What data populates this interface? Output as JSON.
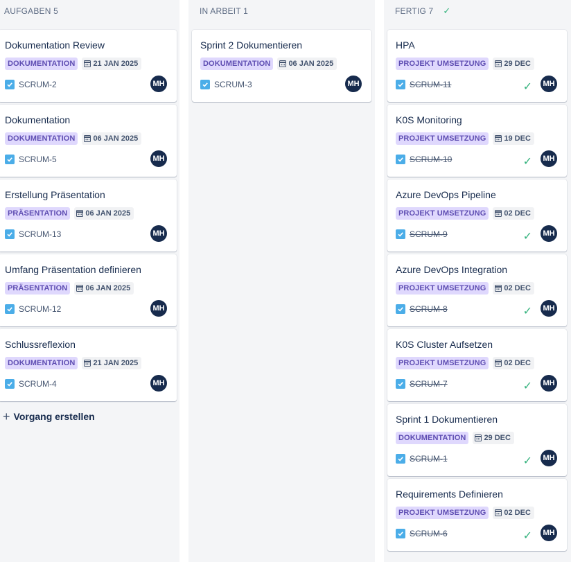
{
  "columns": [
    {
      "id": "todo",
      "title": "AUFGABEN 5",
      "cards": [
        {
          "title": "Dokumentation Review",
          "label": "DOKUMENTATION",
          "date": "21 JAN 2025",
          "key": "SCRUM-2",
          "assignee": "MH"
        },
        {
          "title": "Dokumentation",
          "label": "DOKUMENTATION",
          "date": "06 JAN 2025",
          "key": "SCRUM-5",
          "assignee": "MH"
        },
        {
          "title": "Erstellung Präsentation",
          "label": "PRÄSENTATION",
          "date": "06 JAN 2025",
          "key": "SCRUM-13",
          "assignee": "MH"
        },
        {
          "title": "Umfang Präsentation definieren",
          "label": "PRÄSENTATION",
          "date": "06 JAN 2025",
          "key": "SCRUM-12",
          "assignee": "MH"
        },
        {
          "title": "Schlussreflexion",
          "label": "DOKUMENTATION",
          "date": "21 JAN 2025",
          "key": "SCRUM-4",
          "assignee": "MH"
        }
      ],
      "create_label": "Vorgang erstellen"
    },
    {
      "id": "progress",
      "title": "IN ARBEIT 1",
      "cards": [
        {
          "title": "Sprint 2 Dokumentieren",
          "label": "DOKUMENTATION",
          "date": "06 JAN 2025",
          "key": "SCRUM-3",
          "assignee": "MH"
        }
      ]
    },
    {
      "id": "done",
      "title": "FERTIG 7",
      "cards": [
        {
          "title": "HPA",
          "label": "PROJEKT UMSETZUNG",
          "date": "29 DEC",
          "key": "SCRUM-11",
          "assignee": "MH"
        },
        {
          "title": "K0S Monitoring",
          "label": "PROJEKT UMSETZUNG",
          "date": "19 DEC",
          "key": "SCRUM-10",
          "assignee": "MH"
        },
        {
          "title": "Azure DevOps Pipeline",
          "label": "PROJEKT UMSETZUNG",
          "date": "02 DEC",
          "key": "SCRUM-9",
          "assignee": "MH"
        },
        {
          "title": "Azure DevOps Integration",
          "label": "PROJEKT UMSETZUNG",
          "date": "02 DEC",
          "key": "SCRUM-8",
          "assignee": "MH"
        },
        {
          "title": "K0S Cluster Aufsetzen",
          "label": "PROJEKT UMSETZUNG",
          "date": "02 DEC",
          "key": "SCRUM-7",
          "assignee": "MH"
        },
        {
          "title": "Sprint 1 Dokumentieren",
          "label": "DOKUMENTATION",
          "date": "29 DEC",
          "key": "SCRUM-1",
          "assignee": "MH"
        },
        {
          "title": "Requirements Definieren",
          "label": "PROJEKT UMSETZUNG",
          "date": "02 DEC",
          "key": "SCRUM-6",
          "assignee": "MH"
        }
      ]
    }
  ],
  "icons": {
    "calendar": "calendar-icon",
    "task": "task-checkbox-icon",
    "done": "check-icon",
    "create": "plus-icon"
  },
  "colors": {
    "label_bg": "#dfd8fd",
    "label_text": "#5e4db2",
    "task_icon": "#4bade8",
    "done_check": "#36b37e",
    "avatar_bg": "#172b4d"
  }
}
